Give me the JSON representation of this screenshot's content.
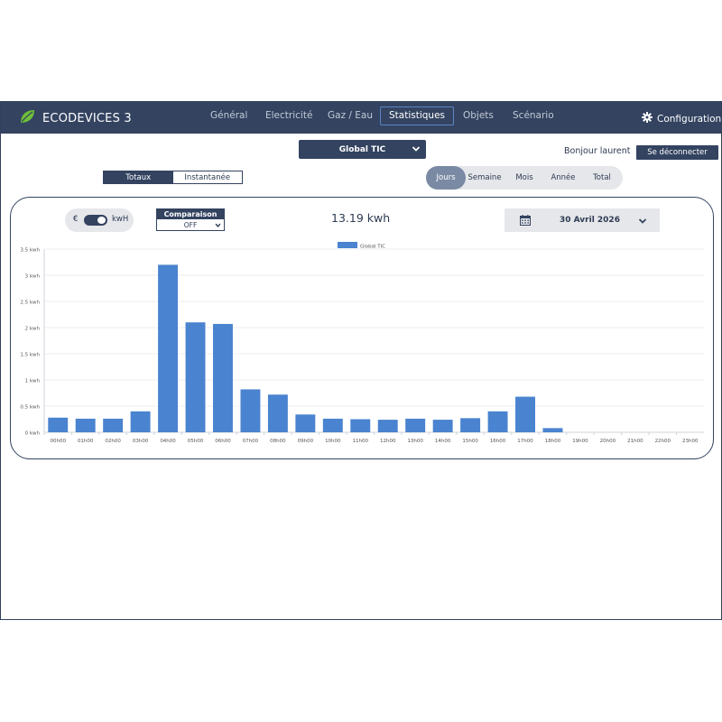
{
  "app": {
    "title": "ECODEVICES 3"
  },
  "nav": {
    "tabs": [
      {
        "label": "Général"
      },
      {
        "label": "Electricité"
      },
      {
        "label": "Gaz / Eau"
      },
      {
        "label": "Statistiques",
        "active": true
      },
      {
        "label": "Objets"
      },
      {
        "label": "Scénario"
      }
    ],
    "config_label": "Configuration"
  },
  "header": {
    "source_select": "Global TIC",
    "greeting": "Bonjour laurent",
    "logout_label": "Se déconnecter"
  },
  "view_toggle": {
    "options": [
      "Totaux",
      "Instantanée"
    ],
    "selected": "Totaux"
  },
  "periods": {
    "options": [
      "Jours",
      "Semaine",
      "Mois",
      "Année",
      "Total"
    ],
    "selected": "Jours"
  },
  "panel": {
    "unit_left": "€",
    "unit_right": "kwH",
    "unit_selected": "kwH",
    "comparison_label": "Comparaison",
    "comparison_value": "OFF",
    "total": "13.19 kwh",
    "date": "30 Avril 2026"
  },
  "colors": {
    "navbar": "#334360",
    "bar": "#4a83cf",
    "accent": "#5b84c4"
  },
  "chart_data": {
    "type": "bar",
    "legend": "Global TIC",
    "legend_position": "top-center",
    "grid": true,
    "categories": [
      "00h00",
      "01h00",
      "02h00",
      "03h00",
      "04h00",
      "05h00",
      "06h00",
      "07h00",
      "08h00",
      "09h00",
      "10h00",
      "11h00",
      "12h00",
      "13h00",
      "14h00",
      "15h00",
      "16h00",
      "17h00",
      "18h00",
      "19h00",
      "20h00",
      "21h00",
      "22h00",
      "23h00"
    ],
    "series": [
      {
        "name": "Global TIC",
        "values": [
          0.28,
          0.26,
          0.26,
          0.4,
          3.2,
          2.1,
          2.07,
          0.82,
          0.72,
          0.34,
          0.26,
          0.25,
          0.24,
          0.26,
          0.24,
          0.27,
          0.4,
          0.68,
          0.08,
          0,
          0,
          0,
          0,
          0
        ]
      }
    ],
    "ylim": [
      0,
      3.5
    ],
    "yticks": [
      "0 kwh",
      "0.5 kwh",
      "1 kwh",
      "1.5 kwh",
      "2 kwh",
      "2.5 kwh",
      "3 kwh",
      "3.5 kwh"
    ]
  }
}
